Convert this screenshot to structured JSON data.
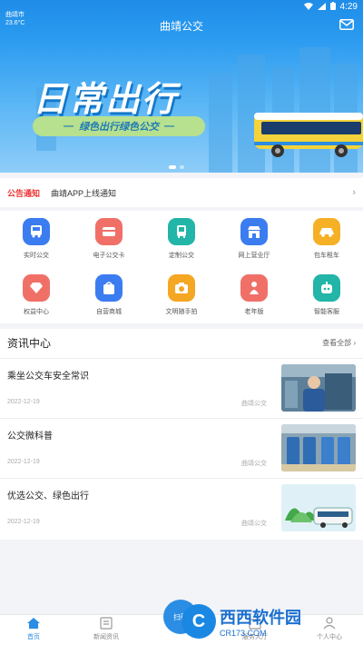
{
  "status_bar": {
    "time": "4:29",
    "location_line1": "曲靖市",
    "location_line2": "23.6°C"
  },
  "header": {
    "title": "曲靖公交"
  },
  "banner": {
    "title": "日常出行",
    "slogan": "绿色出行绿色公交"
  },
  "notice": {
    "tag": "公告通知",
    "text": "曲靖APP上线通知"
  },
  "services": [
    {
      "label": "实时公交",
      "icon": "bus-icon",
      "color": "#3b7cf0"
    },
    {
      "label": "电子公交卡",
      "icon": "card-icon",
      "color": "#f07068"
    },
    {
      "label": "定制公交",
      "icon": "custom-bus-icon",
      "color": "#22b5a8"
    },
    {
      "label": "网上营业厅",
      "icon": "storefront-icon",
      "color": "#3b7cf0"
    },
    {
      "label": "包车租车",
      "icon": "car-icon",
      "color": "#f5b026"
    },
    {
      "label": "权益中心",
      "icon": "diamond-icon",
      "color": "#f07068"
    },
    {
      "label": "自营商城",
      "icon": "shopping-bag-icon",
      "color": "#3b7cf0"
    },
    {
      "label": "文明随手拍",
      "icon": "camera-icon",
      "color": "#f5a623"
    },
    {
      "label": "老年版",
      "icon": "elderly-icon",
      "color": "#f07068"
    },
    {
      "label": "智能客服",
      "icon": "robot-icon",
      "color": "#22b5a8"
    }
  ],
  "news": {
    "title": "资讯中心",
    "more": "查看全部 ›",
    "items": [
      {
        "title": "乘坐公交车安全常识",
        "date": "2022-12-19",
        "source": "曲靖公交"
      },
      {
        "title": "公交微科普",
        "date": "2022-12-19",
        "source": "曲靖公交"
      },
      {
        "title": "优选公交、绿色出行",
        "date": "2022-12-19",
        "source": "曲靖公交"
      }
    ]
  },
  "nav": {
    "tabs": [
      {
        "label": "首页",
        "icon": "home-icon"
      },
      {
        "label": "新闻资讯",
        "icon": "news-icon"
      },
      {
        "label": "服务大厅",
        "icon": "service-icon"
      },
      {
        "label": "个人中心",
        "icon": "person-icon"
      }
    ],
    "fab_label": "扫码"
  },
  "watermark": {
    "brand": "西西软件园",
    "site": "CR173.COM"
  },
  "colors": {
    "primary": "#2b8de3",
    "notice_tag": "#e33333"
  }
}
